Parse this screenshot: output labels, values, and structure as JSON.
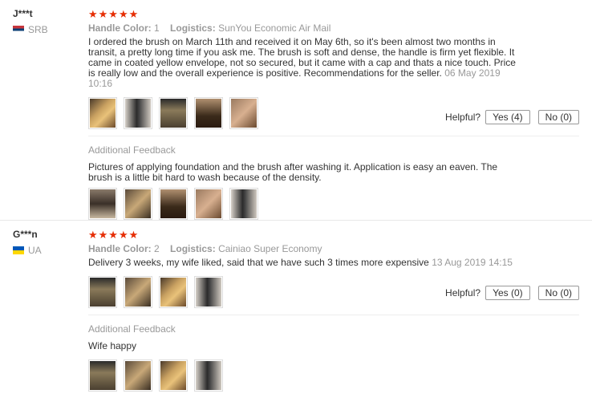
{
  "reviews": [
    {
      "user": "J***t",
      "country": "SRB",
      "stars": "★★★★★",
      "color_label": "Handle Color:",
      "color_value": "1",
      "logistics_label": "Logistics:",
      "logistics_value": "SunYou Economic Air Mail",
      "text": "I ordered the brush on March 11th and received it on May 6th, so it's been almost two months in transit, a pretty long time if you ask me. The brush is soft and dense, the handle is firm yet flexible. It came in coated yellow envelope, not so secured, but it came with a cap and thats a nice touch. Price is really low and the overall experience is positive. Recommendations for the seller.",
      "date": "06 May 2019 10:16",
      "helpful_label": "Helpful?",
      "yes_label": "Yes (4)",
      "no_label": "No (0)",
      "additional_label": "Additional Feedback",
      "additional_text": "Pictures of applying foundation and the brush after washing it. Application is easy an eaven. The brush is a little bit hard to wash because of the density."
    },
    {
      "user": "G***n",
      "country": "UA",
      "stars": "★★★★★",
      "color_label": "Handle Color:",
      "color_value": "2",
      "logistics_label": "Logistics:",
      "logistics_value": "Cainiao Super Economy",
      "text": "Delivery 3 weeks, my wife liked, said that we have such 3 times more expensive",
      "date": "13 Aug 2019 14:15",
      "helpful_label": "Helpful?",
      "yes_label": "Yes (0)",
      "no_label": "No (0)",
      "additional_label": "Additional Feedback",
      "additional_text": "Wife happy"
    }
  ]
}
